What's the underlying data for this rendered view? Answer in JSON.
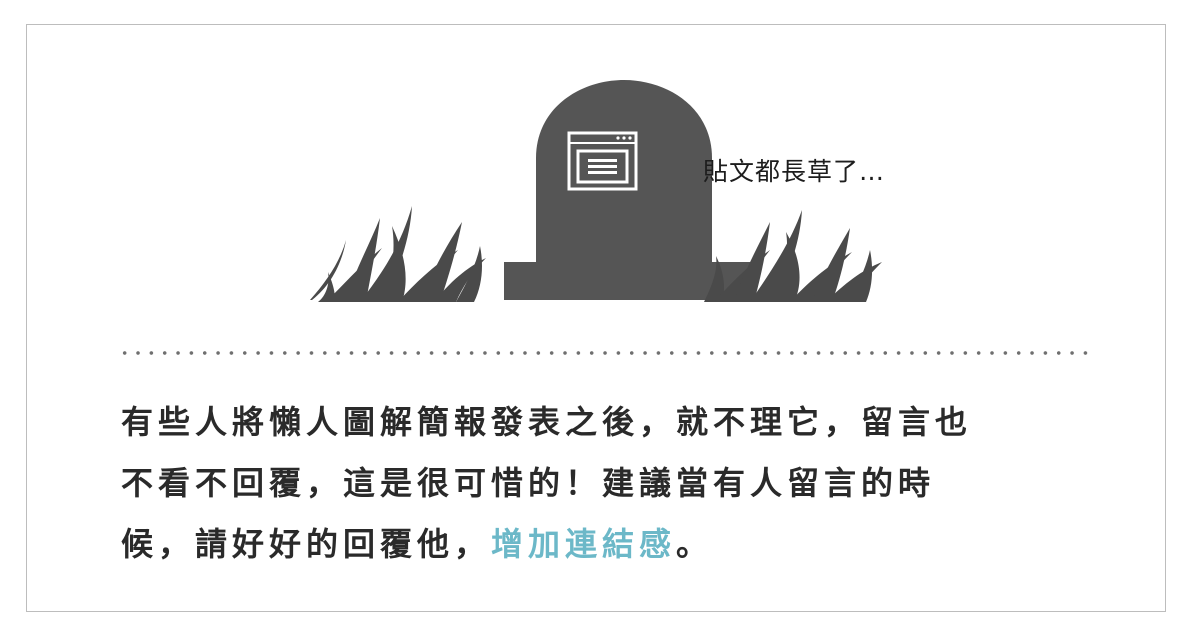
{
  "illustration": {
    "caption": "貼文都長草了…",
    "tombstone_color": "#555555",
    "grass_color": "#4a4a4a",
    "icon": "document-window-icon"
  },
  "body": {
    "line1": "有些人將懶人圖解簡報發表之後，就不理它，留言也",
    "line2": "不看不回覆，這是很可惜的！建議當有人留言的時",
    "line3_pre": "候，請好好的回覆他，",
    "line3_highlight": "增加連結感",
    "line3_post": "。",
    "highlight_color": "#6cb8c8",
    "text_color": "#2a2a2a"
  }
}
